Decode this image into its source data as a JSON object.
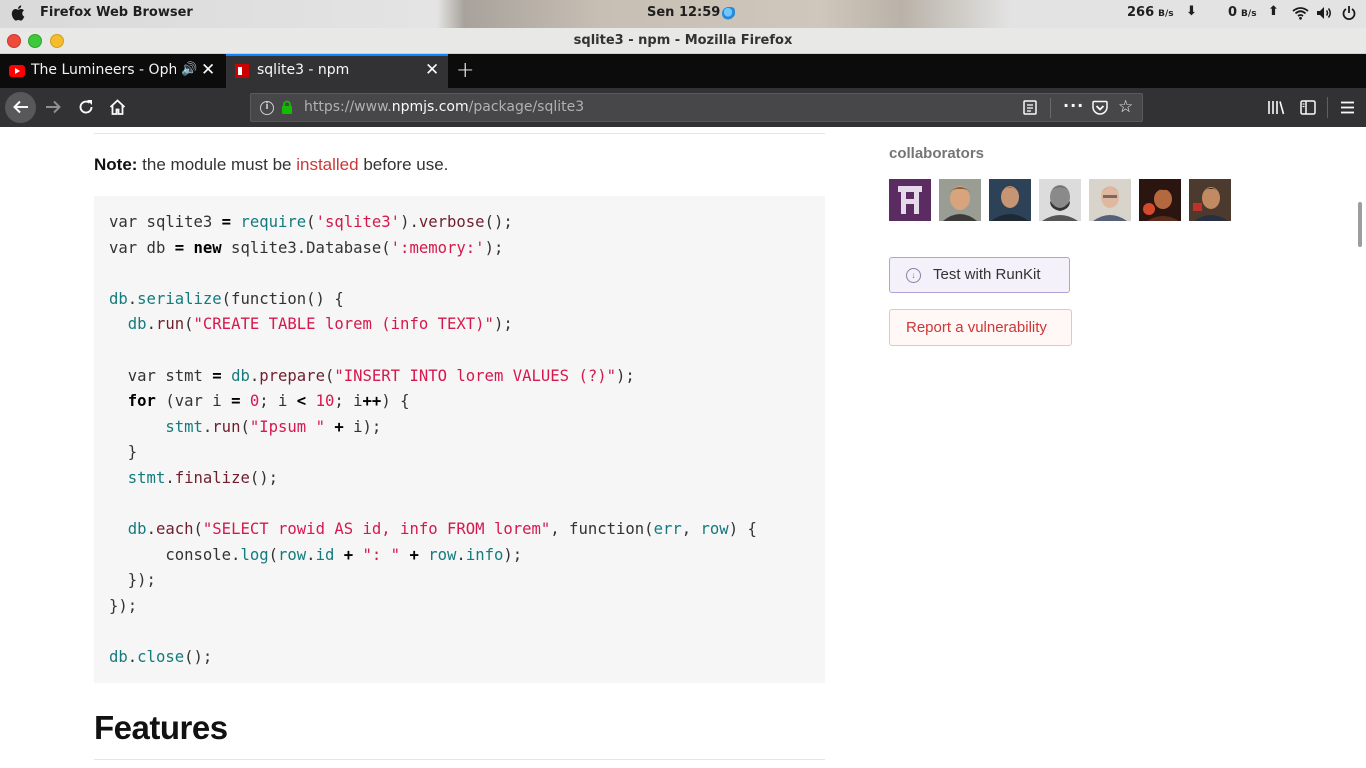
{
  "system_bar": {
    "app_name": "Firefox Web Browser",
    "clock": "Sen 12:59",
    "net_down_value": "266",
    "net_down_unit": "B/s",
    "net_up_value": "0",
    "net_up_unit": "B/s"
  },
  "window": {
    "title": "sqlite3 - npm - Mozilla Firefox"
  },
  "tabs": [
    {
      "label": "The Lumineers - Ophelia",
      "icon": "youtube-icon",
      "audio": true,
      "active": false
    },
    {
      "label": "sqlite3 - npm",
      "icon": "npm-icon",
      "audio": false,
      "active": true
    }
  ],
  "navbar": {
    "url_prefix": "https://www.",
    "url_domain": "npmjs.com",
    "url_path": "/package/sqlite3"
  },
  "content": {
    "note_bold": "Note:",
    "note_pre": " the module must be ",
    "note_link": "installed",
    "note_post": " before use.",
    "heading": "Features"
  },
  "sidebar": {
    "collaborators_title": "collaborators",
    "runkit_label": "Test with RunKit",
    "vulnerability_label": "Report a vulnerability"
  },
  "colors": {
    "npm_red": "#cb3837",
    "tab_active_accent": "#0a84ff",
    "runkit_purple": "#b1a2d6"
  }
}
